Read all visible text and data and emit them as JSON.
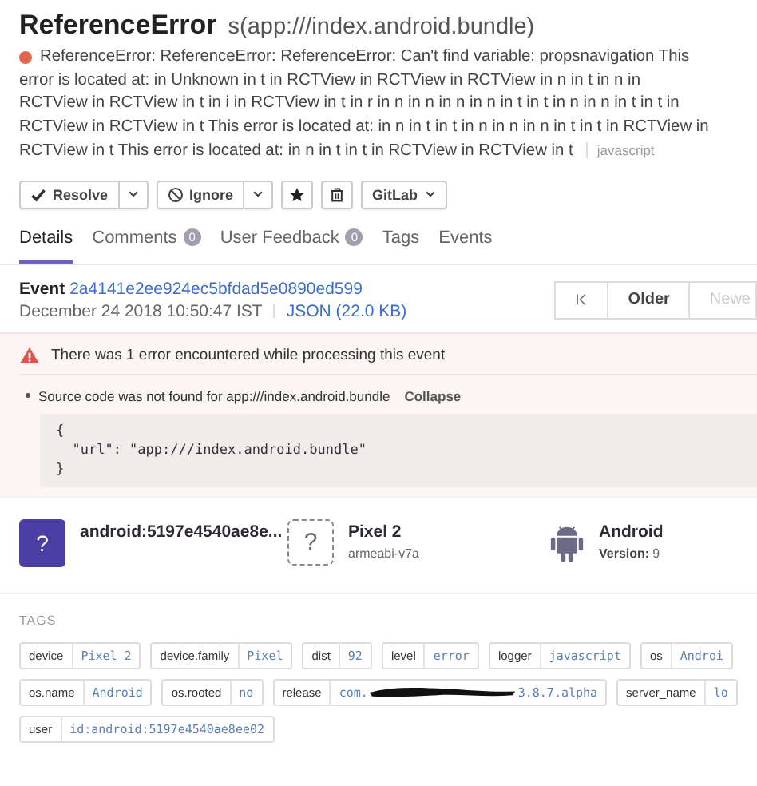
{
  "header": {
    "title": "ReferenceError",
    "culprit": "s(app:///index.android.bundle)",
    "message": "ReferenceError: ReferenceError: ReferenceError: Can't find variable: propsnavigation This error is located at: in Unknown in t in RCTView in RCTView in RCTView in n in t in n in RCTView in RCTView in t in i in RCTView in t in r in n in n in n in n in t in t in n in n in t in t in RCTView in RCTView in t This error is located at: in n in t in t in n in n in n in t in t in RCTView in RCTView in t This error is located at: in n in t in t in RCTView in RCTView in t",
    "platform": "javascript"
  },
  "actions": [
    {
      "kind": "resolve",
      "label": "Resolve"
    },
    {
      "kind": "ignore",
      "label": "Ignore"
    },
    {
      "kind": "bookmark"
    },
    {
      "kind": "delete"
    },
    {
      "kind": "integration",
      "label": "GitLab"
    }
  ],
  "tabs": [
    {
      "label": "Details",
      "selected": true
    },
    {
      "label": "Comments",
      "count": "0",
      "selected": false
    },
    {
      "label": "User Feedback",
      "count": "0",
      "selected": false
    },
    {
      "label": "Tags",
      "selected": false
    },
    {
      "label": "Events",
      "selected": false
    }
  ],
  "event": {
    "label": "Event",
    "id": "2a4141e2ee924ec5bfdad5e0890ed599",
    "date": "December 24 2018 10:50:47 IST",
    "json_link": "JSON (22.0 KB)"
  },
  "pager": [
    {
      "kind": "first",
      "disabled": false
    },
    {
      "kind": "text",
      "label": "Older",
      "disabled": false
    },
    {
      "kind": "text",
      "label": "Newe",
      "disabled": true
    }
  ],
  "errors": {
    "banner": "There was 1 error encountered while processing this event",
    "items": [
      {
        "message": "Source code was not found for app:///index.android.bundle",
        "toggle": "Collapse",
        "expanded": true,
        "code": "{\n  \"url\": \"app:///index.android.bundle\"\n}"
      }
    ]
  },
  "contexts": [
    {
      "kind": "user",
      "initial": "?",
      "title": "android:5197e4540ae8e..."
    },
    {
      "kind": "device",
      "glyph": "?",
      "title": "Pixel 2",
      "subtitle": "armeabi-v7a"
    },
    {
      "kind": "os",
      "title": "Android",
      "sub_label": "Version:",
      "sub_value": "9"
    }
  ],
  "tags": {
    "heading": "TAGS",
    "items": [
      {
        "key": "device",
        "value": "Pixel 2"
      },
      {
        "key": "device.family",
        "value": "Pixel"
      },
      {
        "key": "dist",
        "value": "92"
      },
      {
        "key": "level",
        "value": "error"
      },
      {
        "key": "logger",
        "value": "javascript"
      },
      {
        "key": "os",
        "value": "Androi"
      },
      {
        "key": "os.name",
        "value": "Android"
      },
      {
        "key": "os.rooted",
        "value": "no"
      },
      {
        "key": "release",
        "value": "com.",
        "value_end": "3.8.7.alpha",
        "redacted": true
      },
      {
        "key": "server_name",
        "value": "lo"
      },
      {
        "key": "user",
        "value": "id:android:5197e4540ae8ee02"
      }
    ]
  }
}
